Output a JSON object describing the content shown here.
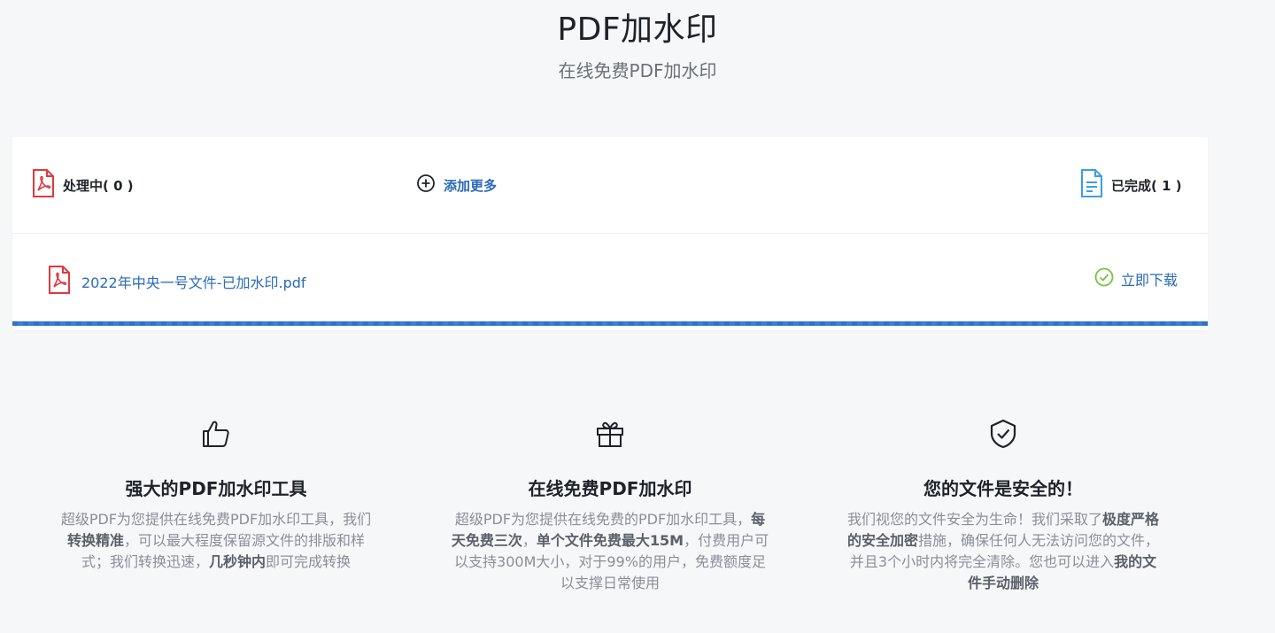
{
  "header": {
    "title": "PDF加水印",
    "subtitle": "在线免费PDF加水印"
  },
  "panel": {
    "processing_label": "处理中",
    "processing_count": "( 0 )",
    "add_more_label": "添加更多",
    "completed_label": "已完成",
    "completed_count": "( 1 )",
    "progress": 1.0
  },
  "files": [
    {
      "name": "2022年中央一号文件-已加水印.pdf",
      "action_label": "立即下载"
    }
  ],
  "features": [
    {
      "icon": "thumbs-up-icon",
      "title": "强大的PDF加水印工具",
      "desc_parts": [
        "超级PDF为您提供在线免费PDF加水印工具，我们",
        "转换精准",
        "，可以最大程度保留源文件的排版和样式；我们转换迅速，",
        "几秒钟内",
        "即可完成转换"
      ]
    },
    {
      "icon": "gift-icon",
      "title": "在线免费PDF加水印",
      "desc_parts": [
        "超级PDF为您提供在线免费的PDF加水印工具，",
        "每天免费三次",
        "，",
        "单个文件免费最大15M",
        "，付费用户可以支持300M大小，对于99%的用户，免费额度足以支撑日常使用"
      ]
    },
    {
      "icon": "shield-check-icon",
      "title": "您的文件是安全的！",
      "desc_parts": [
        "我们视您的文件安全为生命！我们采取了",
        "极度严格的安全加密",
        "措施，确保任何人无法访问您的文件，并且3个小时内将完全清除。您也可以进入",
        "我的文件手动删除",
        ""
      ]
    }
  ],
  "colors": {
    "accent": "#2a6ab8",
    "pdf_red": "#e0393e",
    "done_blue": "#3aa0e0",
    "success_green": "#7ac143"
  }
}
